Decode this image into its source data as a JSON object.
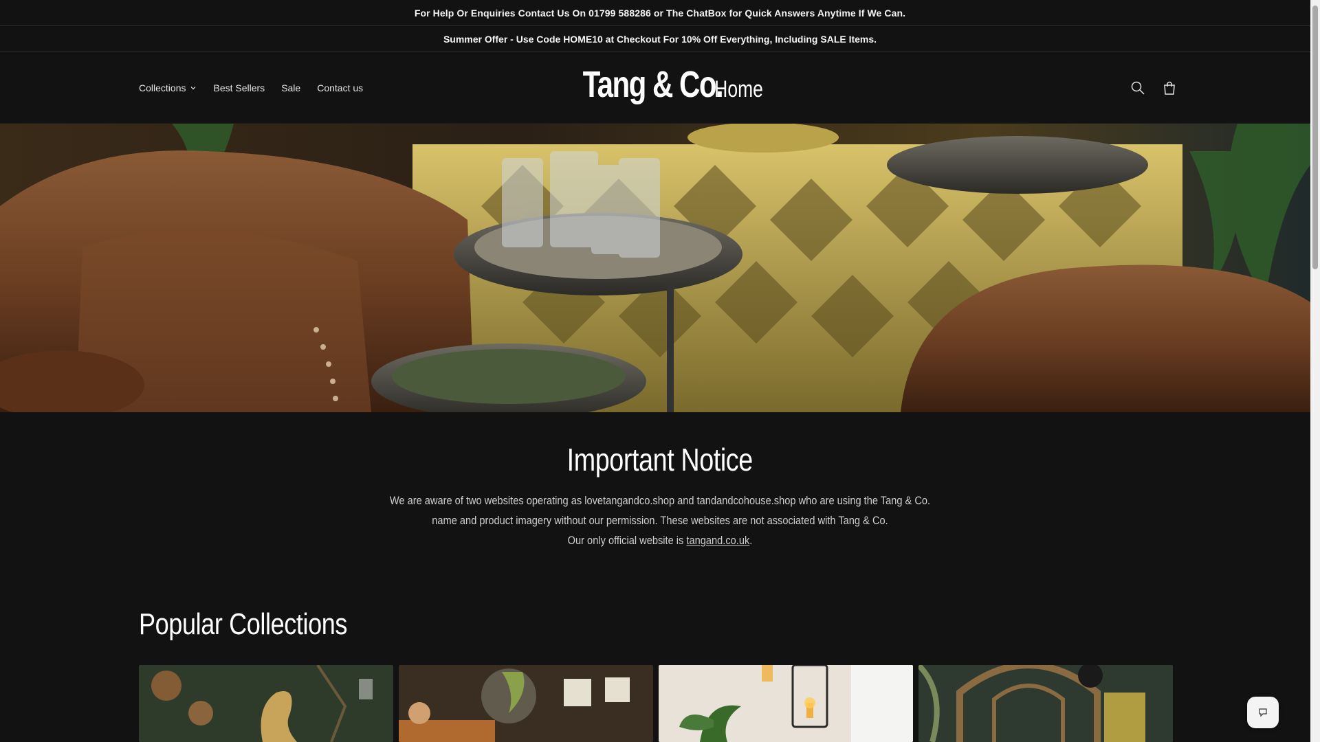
{
  "announcements": [
    "For Help Or Enquiries Contact Us On 01799 588286 or The ChatBox for Quick Answers Anytime If We Can.",
    "Summer Offer - Use Code HOME10 at Checkout For 10% Off Everything, Including SALE Items."
  ],
  "nav": {
    "items": [
      {
        "label": "Collections",
        "icon": "chevron-down-icon"
      },
      {
        "label": "Best Sellers"
      },
      {
        "label": "Sale"
      },
      {
        "label": "Contact us"
      }
    ]
  },
  "logo": {
    "main": "Tang & Co.",
    "sub": "Home"
  },
  "header_icons": [
    "search-icon",
    "cart-icon"
  ],
  "notice": {
    "title": "Important Notice",
    "line1": "We are aware of two websites operating as lovetangandco.shop and tandandcohouse.shop who are using the Tang & Co.",
    "line2": "name and product imagery without our permission. These websites are not associated with Tang & Co.",
    "line3_prefix": "Our only official website is ",
    "link": "tangand.co.uk",
    "line3_suffix": "."
  },
  "popular": {
    "title": "Popular Collections"
  },
  "chat": {
    "icon": "chat-icon"
  },
  "colors": {
    "background": "#121212",
    "text": "#f2f2f2",
    "muted": "#cfcfcf"
  }
}
